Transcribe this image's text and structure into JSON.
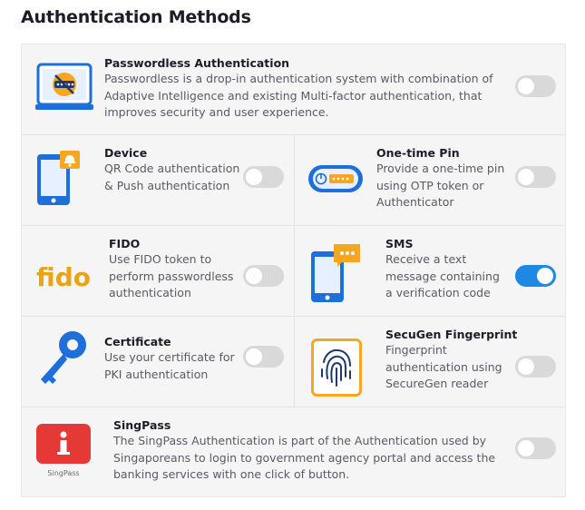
{
  "page": {
    "title": "Authentication Methods"
  },
  "colors": {
    "toggle_on": "#1e88e5",
    "toggle_off": "#d9d9d9",
    "icon_blue": "#1e6fd9",
    "icon_orange": "#f5a623",
    "singpass_red": "#e53935"
  },
  "methods": {
    "passwordless": {
      "name": "Passwordless Authentication",
      "description": "Passwordless is a drop-in authentication system with combination of Adaptive Intelligence and existing Multi-factor authentication, that improves security and user experience.",
      "enabled": false,
      "icon": "laptop-no-password-icon"
    },
    "device": {
      "name": "Device",
      "description": "QR Code authentication & Push authentication",
      "enabled": false,
      "icon": "mobile-notification-icon"
    },
    "otp": {
      "name": "One-time Pin",
      "description": "Provide a one-time pin using OTP token or Authenticator",
      "enabled": false,
      "icon": "otp-token-icon"
    },
    "fido": {
      "name": "FIDO",
      "description": "Use FIDO token to perform passwordless authentication",
      "enabled": false,
      "icon": "fido-logo",
      "logo_text": "fido"
    },
    "sms": {
      "name": "SMS",
      "description": "Receive a text message containing a verification code",
      "enabled": true,
      "icon": "mobile-message-icon"
    },
    "certificate": {
      "name": "Certificate",
      "description": "Use your certificate for PKI authentication",
      "enabled": false,
      "icon": "key-icon"
    },
    "fingerprint": {
      "name": "SecuGen Fingerprint",
      "description": "Fingerprint authentication using SecureGen reader",
      "enabled": false,
      "icon": "fingerprint-icon"
    },
    "singpass": {
      "name": "SingPass",
      "description": "The SingPass Authentication is part of the Authentication used by Singaporeans to login to government agency portal and access the banking services with one click of button.",
      "enabled": false,
      "icon": "singpass-logo",
      "logo_text": "SingPass"
    }
  }
}
